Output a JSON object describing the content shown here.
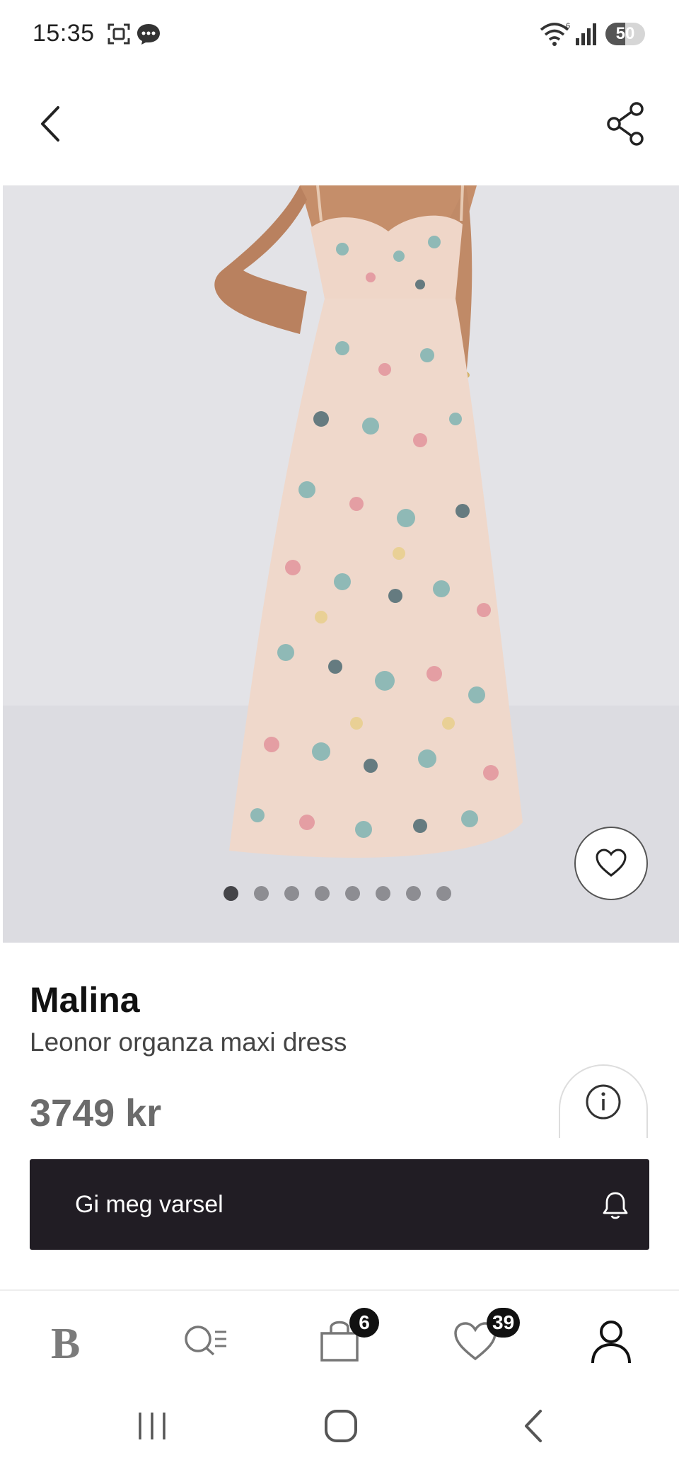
{
  "status_bar": {
    "time": "15:35",
    "battery": "50",
    "battery_level": 0.5,
    "icons": [
      "screenshot-icon",
      "chat-bubble-icon",
      "wifi-icon",
      "signal-icon",
      "battery-icon"
    ]
  },
  "app_bar": {
    "back_icon": "chevron-left-icon",
    "share_icon": "share-icon"
  },
  "gallery": {
    "image": "floral-organza-maxi-dress-photo",
    "slide_count": 8,
    "active_slide": 1,
    "favorite_icon": "heart-icon"
  },
  "product": {
    "brand": "Malina",
    "name": "Leonor organza maxi dress",
    "price": "3749 kr",
    "info_icon": "info-icon"
  },
  "notify_button": {
    "label": "Gi meg varsel",
    "icon": "bell-icon"
  },
  "bottom_nav": {
    "home_logo": "B",
    "cart_badge": "6",
    "wishlist_badge": "39",
    "icons": [
      "brand-logo",
      "search-list-icon",
      "shopping-bag-icon",
      "heart-icon",
      "user-icon"
    ]
  },
  "colors": {
    "notify_bg": "#211d24",
    "hero_bg": "#e3e3e7",
    "badge_bg": "#111111"
  }
}
